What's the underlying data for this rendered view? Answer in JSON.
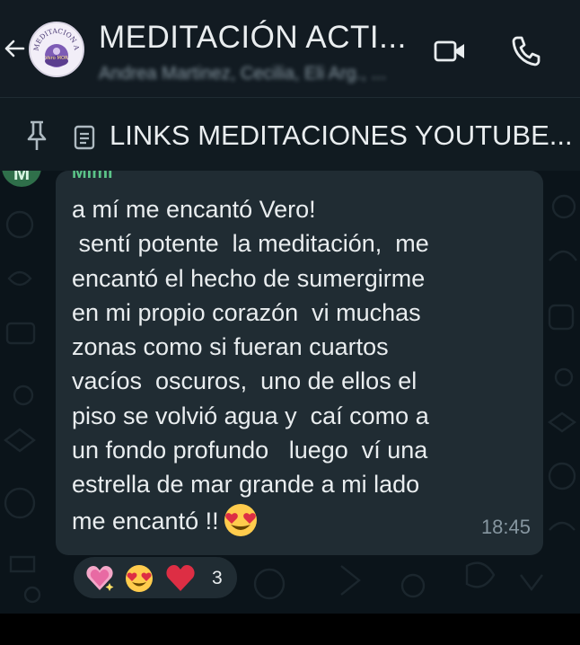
{
  "header": {
    "title": "MEDITACIÓN ACTI...",
    "subtitle": "Andrea Martinez, Cecilia, Eli Arg., ...",
    "avatar_text": "MEDITACION ACT",
    "avatar_badge": "Vero MOR"
  },
  "pinned": {
    "text": "LINKS MEDITACIONES YOUTUBE..."
  },
  "message": {
    "sender_initial": "M",
    "sender_name": "Mimi",
    "text": "a mí me encantó Vero!\n sentí potente  la meditación,  me\nencantó el hecho de sumergirme\nen mi propio corazón  vi muchas\nzonas como si fueran cuartos\nvacíos  oscuros,  uno de ellos el\npiso se volvió agua y  caí como a\nun fondo profundo   luego  ví una\nestrella de mar grande a mi lado\nme encantó !!",
    "emoji": "heart-eyes-emoji",
    "time": "18:45"
  },
  "reactions": {
    "items": [
      "sparkling-heart-emoji",
      "heart-eyes-emoji",
      "red-heart-emoji"
    ],
    "count": "3"
  },
  "colors": {
    "background": "#0b141a",
    "header": "#121b22",
    "bubble": "#202c33",
    "text": "#e9edef",
    "meta": "#8696a0",
    "sender": "#5bc488"
  },
  "icons": [
    "back-arrow-icon",
    "video-call-icon",
    "phone-icon",
    "pin-icon",
    "document-icon"
  ]
}
